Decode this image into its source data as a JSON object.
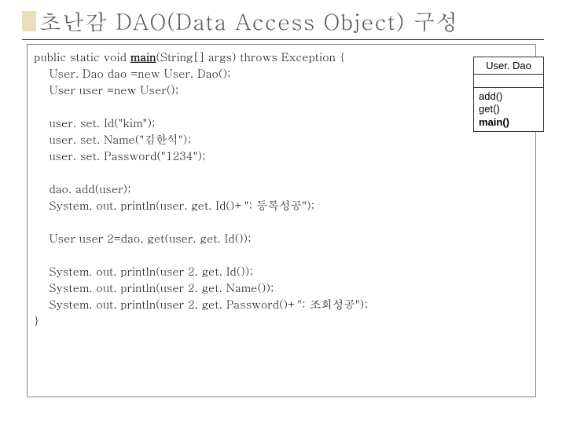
{
  "title": "초난감  DAO(Data Access Object)  구성",
  "code": {
    "l1a": "public static void ",
    "l1b": "main",
    "l1c": "(String[] args) throws Exception {",
    "l2": "    User. Dao dao =new User. Dao();",
    "l3": "    User user =new User();",
    "l4": "",
    "l5": "    user. set. Id(\"kim\");",
    "l6": "    user. set. Name(\"김한석\");",
    "l7": "    user. set. Password(\"1234\");",
    "l8": "",
    "l9": "    dao. add(user);",
    "l10": "    System. out. println(user. get. Id()+\": 등록성공\");",
    "l11": "",
    "l12": "    User user 2=dao. get(user. get. Id());",
    "l13": "",
    "l14": "    System. out. println(user 2. get. Id());",
    "l15": "    System. out. println(user 2. get. Name());",
    "l16": "    System. out. println(user 2. get. Password()+\": 조회성공\");",
    "l17": "}"
  },
  "uml": {
    "class_name": "User. Dao",
    "m1": "add()",
    "m2": "get()",
    "m3": "main()"
  }
}
